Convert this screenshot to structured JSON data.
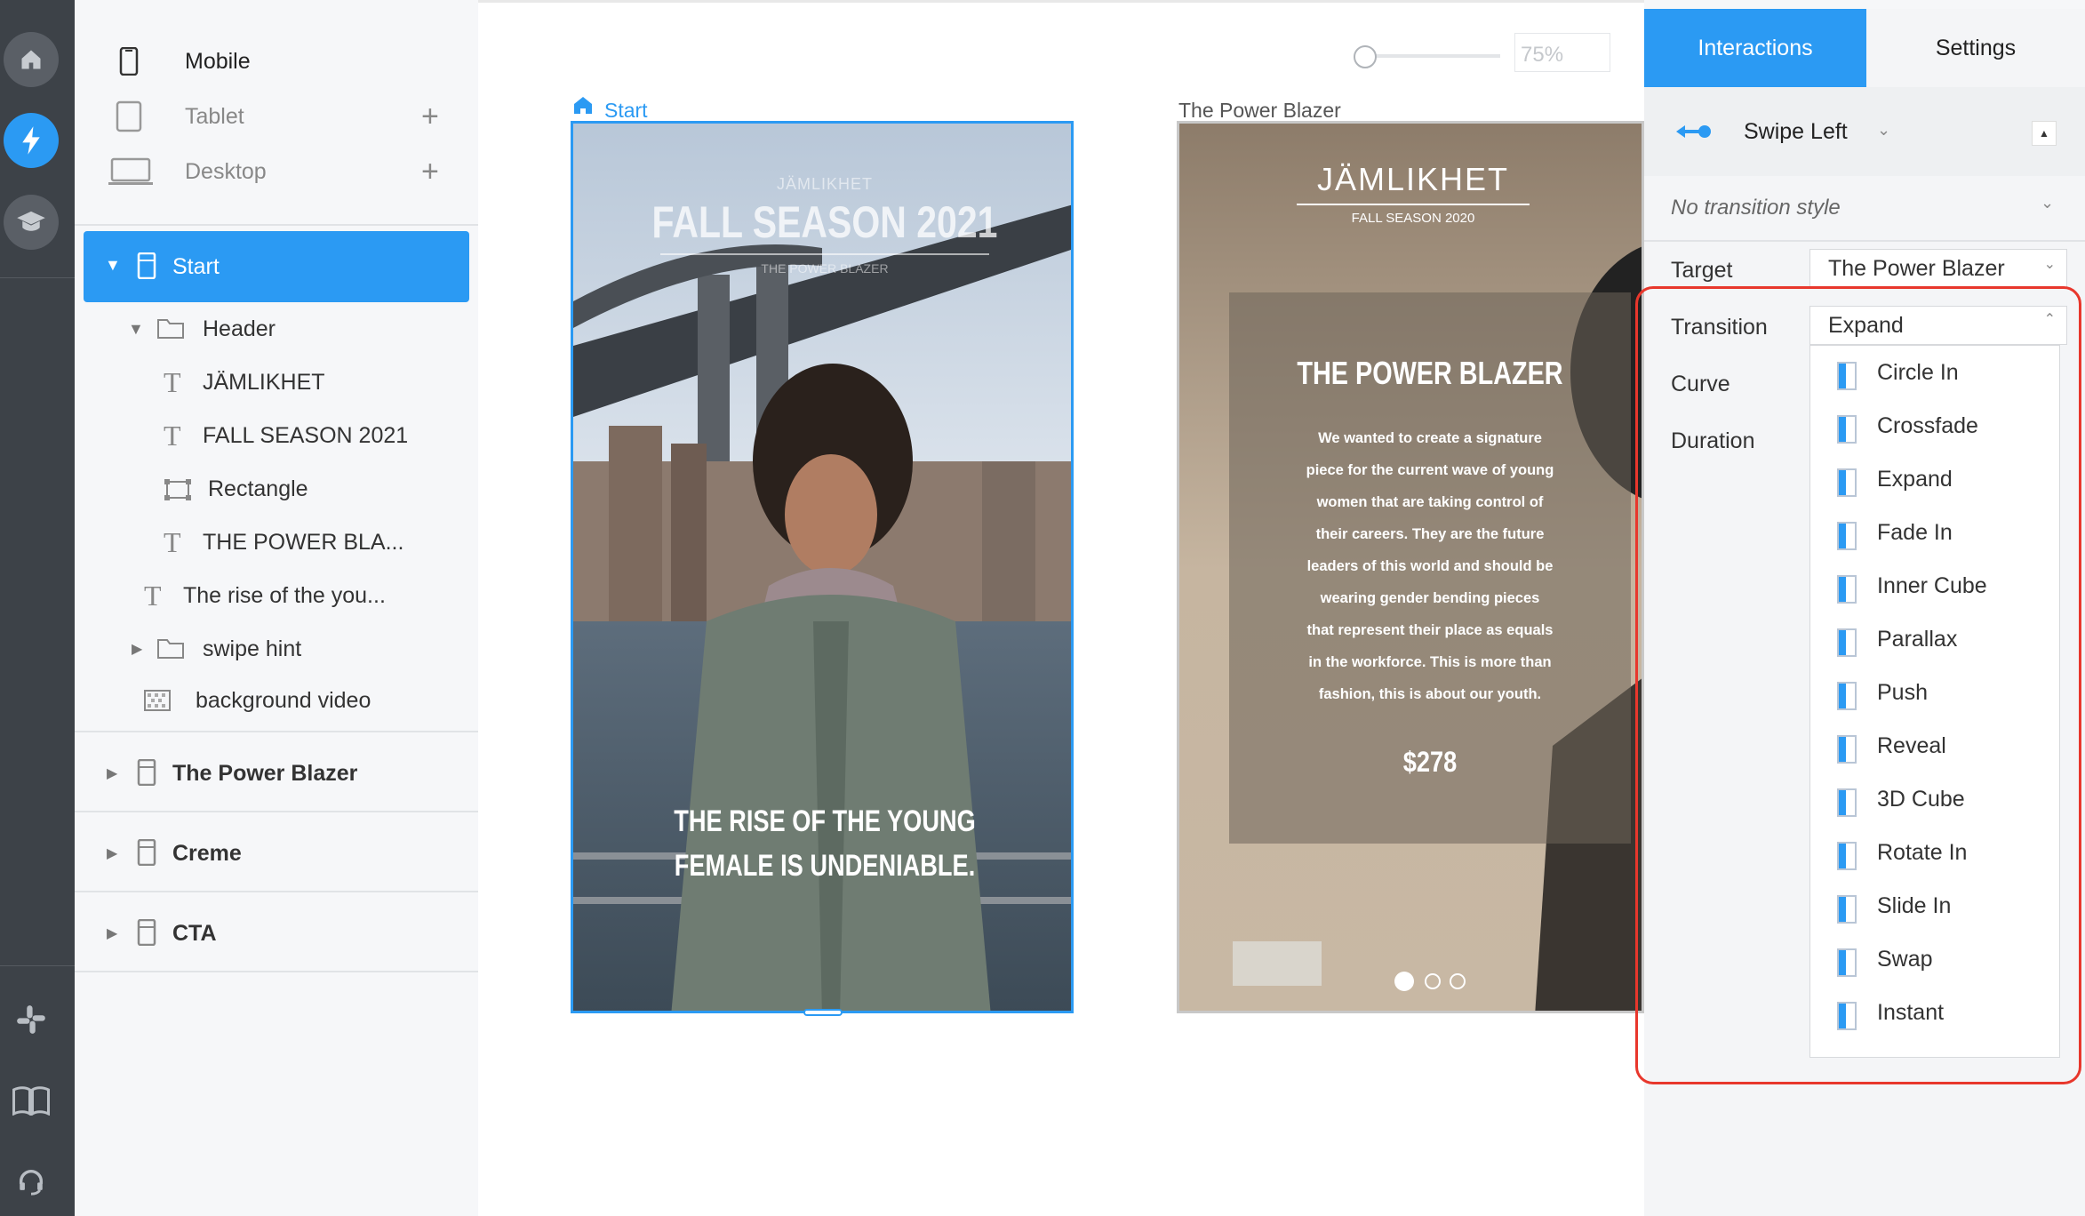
{
  "devices": [
    {
      "label": "Mobile",
      "icon": "mobile-icon",
      "has_add": false
    },
    {
      "label": "Tablet",
      "icon": "tablet-icon",
      "has_add": true
    },
    {
      "label": "Desktop",
      "icon": "desktop-icon",
      "has_add": true
    }
  ],
  "layers": {
    "start": "Start",
    "header": "Header",
    "jamlikhet": "JÄMLIKHET",
    "fall_season": "FALL SEASON 2021",
    "rectangle": "Rectangle",
    "power_short": "THE POWER BLA...",
    "rise_short": "The rise of the you...",
    "swipe_hint": "swipe hint",
    "background_video": "background video",
    "screens": [
      "The Power Blazer",
      "Creme",
      "CTA"
    ]
  },
  "canvas": {
    "zoom": "75%",
    "zoom_level": 0.05,
    "screen1_label": "Start",
    "screen2_label": "The Power Blazer",
    "s1": {
      "brand": "JÄMLIKHET",
      "season": "FALL SEASON 2021",
      "sub": "THE POWER BLAZER",
      "tagline_1": "THE RISE OF THE YOUNG",
      "tagline_2": "FEMALE IS UNDENIABLE."
    },
    "s2": {
      "brand": "JÄMLIKHET",
      "season": "FALL SEASON 2020",
      "title": "THE POWER BLAZER",
      "body": [
        "We wanted to create a signature",
        "piece for the current wave of young",
        "women that are taking control of",
        "their careers. They are the future",
        "leaders of this world and should be",
        "wearing gender bending pieces",
        "that represent their place as equals",
        "in the workforce. This is more than",
        "fashion, this is about our youth."
      ],
      "price": "$278"
    }
  },
  "panel": {
    "tab_interactions": "Interactions",
    "tab_settings": "Settings",
    "gesture": "Swipe Left",
    "transition_style": "No transition style",
    "target_label": "Target",
    "target_value": "The Power Blazer",
    "transition_label": "Transition",
    "transition_value": "Expand",
    "curve_label": "Curve",
    "duration_label": "Duration",
    "options": [
      "Circle In",
      "Crossfade",
      "Expand",
      "Fade In",
      "Inner Cube",
      "Parallax",
      "Push",
      "Reveal",
      "3D Cube",
      "Rotate In",
      "Slide In",
      "Swap",
      "Instant"
    ]
  },
  "colors": {
    "accent": "#2b9af3",
    "rail": "#3d4248",
    "highlight": "#e8372c"
  }
}
